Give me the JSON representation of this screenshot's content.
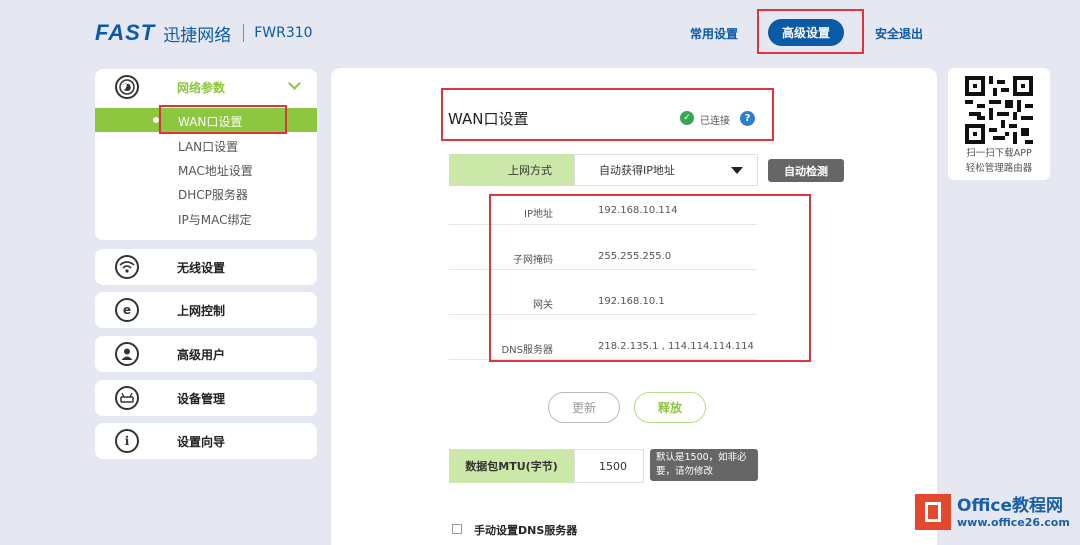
{
  "header": {
    "brand": "FAST",
    "brand_cn": "迅捷网络",
    "model": "FWR310",
    "nav": {
      "common": "常用设置",
      "advanced": "高级设置",
      "logout": "安全退出"
    }
  },
  "sidebar": {
    "network": {
      "title": "网络参数",
      "items": [
        "WAN口设置",
        "LAN口设置",
        "MAC地址设置",
        "DHCP服务器",
        "IP与MAC绑定"
      ],
      "active": "WAN口设置"
    },
    "sections": [
      {
        "title": "无线设置",
        "icon": "wifi-icon"
      },
      {
        "title": "上网控制",
        "icon": "internet-explorer-icon"
      },
      {
        "title": "高级用户",
        "icon": "user-icon"
      },
      {
        "title": "设备管理",
        "icon": "router-icon"
      },
      {
        "title": "设置向导",
        "icon": "info-icon"
      }
    ]
  },
  "main": {
    "title": "WAN口设置",
    "status": "已连接",
    "connection": {
      "label": "上网方式",
      "value": "自动获得IP地址",
      "detect_button": "自动检测"
    },
    "info": [
      {
        "label": "IP地址",
        "value": "192.168.10.114"
      },
      {
        "label": "子网掩码",
        "value": "255.255.255.0"
      },
      {
        "label": "网关",
        "value": "192.168.10.1"
      },
      {
        "label": "DNS服务器",
        "value": "218.2.135.1 , 114.114.114.114"
      }
    ],
    "buttons": {
      "refresh": "更新",
      "release": "释放"
    },
    "mtu": {
      "label": "数据包MTU(字节)",
      "value": "1500",
      "tip": "默认是1500，如非必要，请勿修改"
    },
    "manual_dns": "手动设置DNS服务器"
  },
  "qr": {
    "line1": "扫一扫下载APP",
    "line2": "轻松管理路由器"
  },
  "watermark": {
    "brand": "Office教程网",
    "url": "www.office26.com"
  },
  "colors": {
    "brand_blue": "#0b5aa8",
    "accent_green": "#8dc63f",
    "annotation_red": "#e0343c"
  }
}
